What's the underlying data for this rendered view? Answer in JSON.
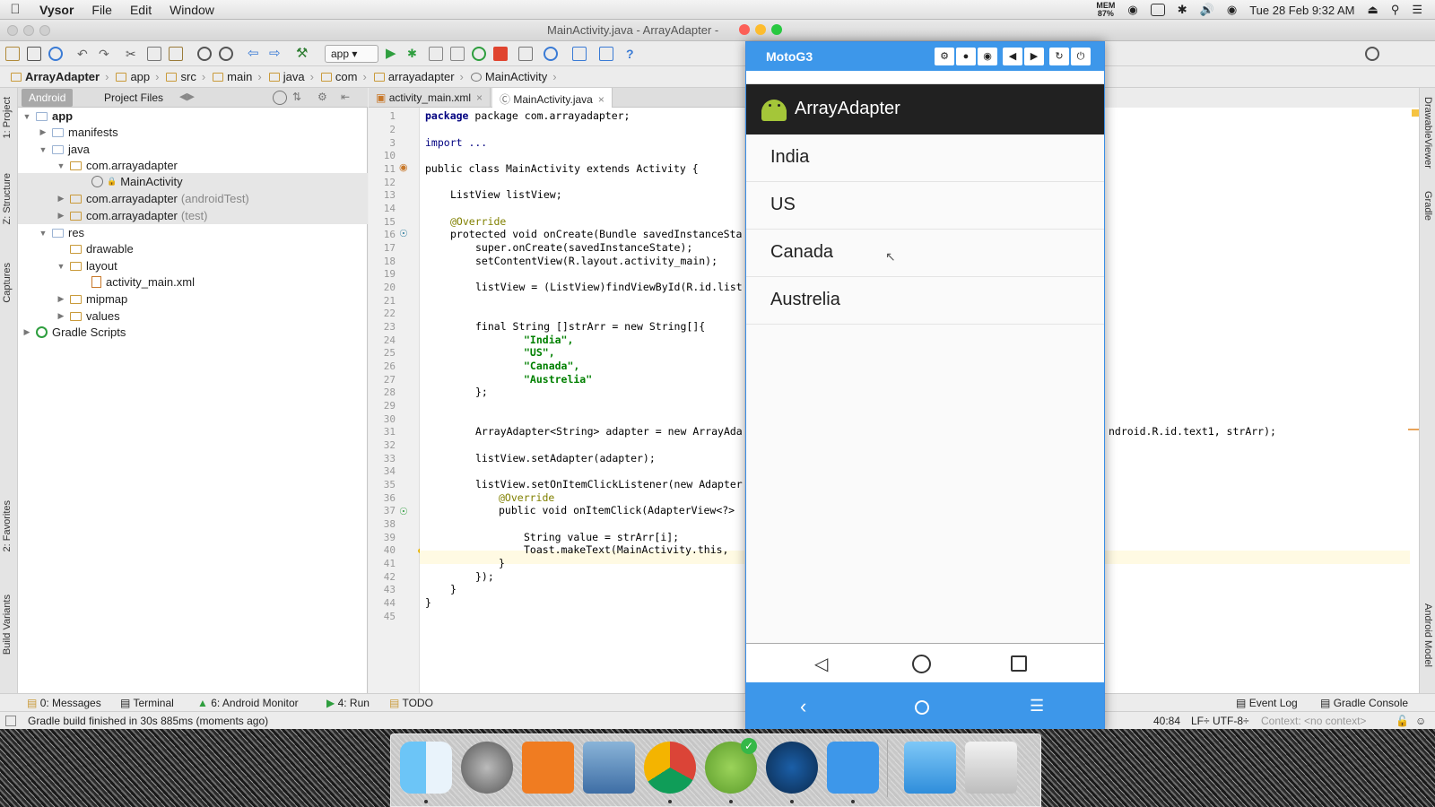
{
  "menubar": {
    "app_name": "Vysor",
    "items": [
      "File",
      "Edit",
      "Window"
    ],
    "mem_label": "MEM",
    "mem_value": "87%",
    "datetime": "Tue 28 Feb  9:32 AM"
  },
  "window": {
    "title": "MainActivity.java - ArrayAdapter -"
  },
  "toolbar": {
    "run_config": "app"
  },
  "breadcrumbs": [
    "ArrayAdapter",
    "app",
    "src",
    "main",
    "java",
    "com",
    "arrayadapter",
    "MainActivity"
  ],
  "project_panel": {
    "tabs": [
      "Android",
      "Project Files"
    ],
    "tree": [
      {
        "label": "app",
        "bold": true
      },
      {
        "label": "manifests"
      },
      {
        "label": "java"
      },
      {
        "label": "com.arrayadapter"
      },
      {
        "label": "MainActivity"
      },
      {
        "label": "com.arrayadapter",
        "suffix": "(androidTest)"
      },
      {
        "label": "com.arrayadapter",
        "suffix": "(test)"
      },
      {
        "label": "res"
      },
      {
        "label": "drawable"
      },
      {
        "label": "layout"
      },
      {
        "label": "activity_main.xml"
      },
      {
        "label": "mipmap"
      },
      {
        "label": "values"
      },
      {
        "label": "Gradle Scripts"
      }
    ]
  },
  "editor": {
    "tabs": [
      "activity_main.xml",
      "MainActivity.java"
    ],
    "line_numbers": [
      "1",
      "2",
      "3",
      "10",
      "11",
      "12",
      "13",
      "14",
      "15",
      "16",
      "17",
      "18",
      "19",
      "20",
      "21",
      "22",
      "23",
      "24",
      "25",
      "26",
      "27",
      "28",
      "29",
      "30",
      "31",
      "32",
      "33",
      "34",
      "35",
      "36",
      "37",
      "38",
      "39",
      "40",
      "41",
      "42",
      "43",
      "44",
      "45"
    ],
    "lines": {
      "l1": "package com.arrayadapter;",
      "l3": "import ...",
      "l11": "public class MainActivity extends Activity {",
      "l13": "ListView listView;",
      "l15": "@Override",
      "l16": "protected void onCreate(Bundle savedInstanceSta",
      "l17": "super.onCreate(savedInstanceState);",
      "l18": "setContentView(R.layout.activity_main);",
      "l20": "listView = (ListView)findViewById(R.id.list",
      "l23": "final String []strArr = new String[]{",
      "l24": "\"India\",",
      "l25": "\"US\",",
      "l26": "\"Canada\",",
      "l27": "\"Austrelia\"",
      "l28": "};",
      "l31": "ArrayAdapter<String> adapter = new ArrayAda",
      "l31_tail": "ndroid.R.id.text1, strArr);",
      "l33": "listView.setAdapter(adapter);",
      "l35": "listView.setOnItemClickListener(new Adapter",
      "l36": "@Override",
      "l37": "public void onItemClick(AdapterView<?> ",
      "l39": "String value = strArr[i];",
      "l40": "Toast.makeText(MainActivity.this, ",
      "l41": "}",
      "l42": "});",
      "l43": "}",
      "l44": "}"
    }
  },
  "vysor": {
    "device_name": "MotoG3",
    "app_title": "ArrayAdapter",
    "list_items": [
      "India",
      "US",
      "Canada",
      "Austrelia"
    ]
  },
  "left_strip": [
    "1: Project",
    "Z: Structure",
    "Captures",
    "2: Favorites",
    "Build Variants"
  ],
  "right_strip": [
    "DrawableViewer",
    "Gradle",
    "Android Model"
  ],
  "bottom_tools": {
    "left": [
      "0: Messages",
      "Terminal",
      "6: Android Monitor",
      "4: Run",
      "TODO"
    ],
    "right": [
      "Event Log",
      "Gradle Console"
    ]
  },
  "status": {
    "message": "Gradle build finished in 30s 885ms (moments ago)",
    "position": "40:84",
    "line_sep": "LF÷",
    "encoding": "UTF-8÷",
    "context": "Context: <no context>"
  },
  "colors": {
    "vysor_blue": "#3d97ea",
    "android_green": "#a4c639",
    "app_bar": "#212121"
  },
  "dock_apps": [
    "finder-icon",
    "system-preferences-icon",
    "xampp-icon",
    "preview-icon",
    "chrome-icon",
    "android-studio-icon",
    "quicktime-icon",
    "vysor-icon",
    "folder-icon",
    "trash-icon"
  ]
}
